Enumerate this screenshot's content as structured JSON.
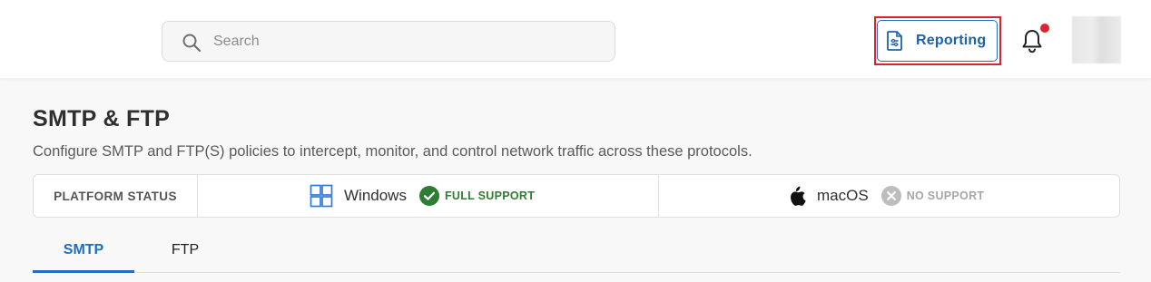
{
  "search": {
    "placeholder": "Search"
  },
  "header": {
    "reporting_label": "Reporting"
  },
  "page": {
    "title": "SMTP & FTP",
    "subtitle": "Configure SMTP and FTP(S) policies to intercept, monitor, and control network traffic across these protocols."
  },
  "platform_status": {
    "label": "PLATFORM STATUS",
    "windows": {
      "name": "Windows",
      "status": "FULL SUPPORT",
      "color": "#2e7d32"
    },
    "macos": {
      "name": "macOS",
      "status": "NO SUPPORT",
      "color": "#a7a7a7"
    }
  },
  "tabs": [
    {
      "label": "SMTP"
    },
    {
      "label": "FTP"
    }
  ],
  "colors": {
    "accent": "#1f6fc0",
    "highlight": "#d9232d",
    "notification": "#e0242f"
  }
}
